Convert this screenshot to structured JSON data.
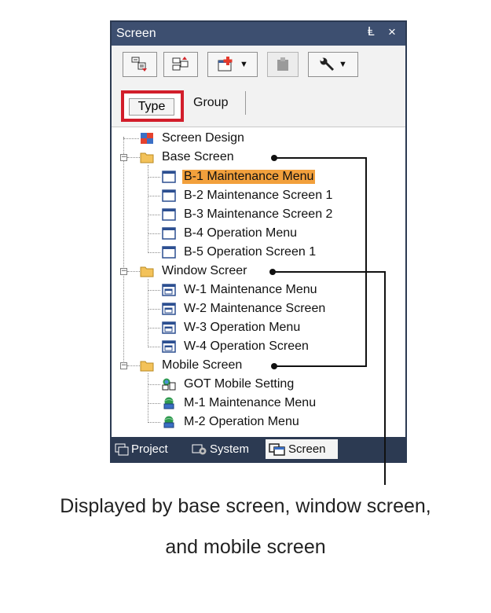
{
  "panel": {
    "title": "Screen",
    "pin_glyph": "Ⱡ",
    "close_glyph": "×"
  },
  "toolbar": {
    "buttons": [
      {
        "icon": "screen-red-arrow-icon",
        "dropdown": false
      },
      {
        "icon": "screen-sort-icon",
        "dropdown": false
      },
      {
        "icon": "new-screen-plus-icon",
        "dropdown": true
      },
      {
        "icon": "paste-disabled-icon",
        "dropdown": false
      },
      {
        "icon": "wrench-icon",
        "dropdown": true
      }
    ]
  },
  "tabs": {
    "type_label": "Type",
    "group_label": "Group"
  },
  "tree": {
    "root": "Screen Design",
    "groups": [
      {
        "label": "Base Screen",
        "items": [
          "B-1 Maintenance Menu",
          "B-2 Maintenance Screen 1",
          "B-3 Maintenance Screen 2",
          "B-4 Operation Menu",
          "B-5 Operation Screen 1"
        ]
      },
      {
        "label": "Window Screer",
        "items": [
          "W-1 Maintenance Menu",
          "W-2 Maintenance Screen",
          "W-3 Operation Menu",
          "W-4 Operation Screen"
        ]
      },
      {
        "label": "Mobile Screen",
        "items": [
          "GOT Mobile Setting",
          "M-1 Maintenance Menu",
          "M-2 Operation Menu"
        ]
      }
    ],
    "selected": "B-1 Maintenance Menu"
  },
  "bottom_tabs": {
    "project": "Project",
    "system": "System",
    "screen": "Screen"
  },
  "caption": {
    "line1": "Displayed by base screen, window screen,",
    "line2": "and mobile screen"
  },
  "colors": {
    "highlight_box": "#d21e2b",
    "selection": "#f2a03c",
    "title_bar": "#3d4f70"
  }
}
